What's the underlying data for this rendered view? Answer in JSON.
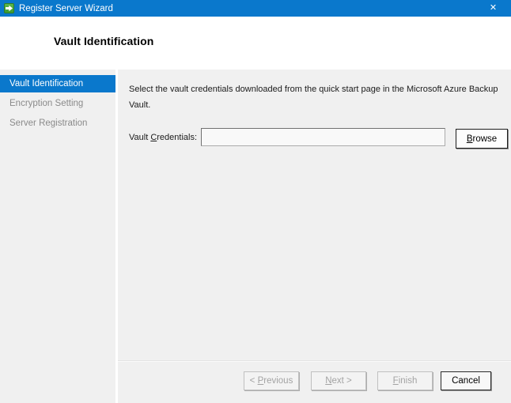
{
  "window": {
    "title": "Register Server Wizard",
    "close_glyph": "✕"
  },
  "header": {
    "title": "Vault Identification"
  },
  "sidebar": {
    "items": [
      {
        "label": "Vault Identification",
        "selected": true
      },
      {
        "label": "Encryption Setting",
        "selected": false
      },
      {
        "label": "Server Registration",
        "selected": false
      }
    ]
  },
  "content": {
    "description": "Select the vault credentials downloaded from the quick start page in the Microsoft Azure Backup Vault.",
    "field": {
      "label_pre": "Vault ",
      "label_key": "C",
      "label_post": "redentials:",
      "value": "",
      "browse_key": "B",
      "browse_post": "rowse"
    }
  },
  "footer": {
    "previous": {
      "pre": "< ",
      "key": "P",
      "post": "revious",
      "enabled": false
    },
    "next": {
      "pre": "",
      "key": "N",
      "post": "ext >",
      "enabled": false
    },
    "finish": {
      "pre": "",
      "key": "F",
      "post": "inish",
      "enabled": false
    },
    "cancel_label": "Cancel"
  },
  "colors": {
    "titlebar": "#0a78cc",
    "selection": "#0a78cc",
    "window_bg": "#f0f0f0",
    "header_bg": "#ffffff",
    "divider": "#ffffff",
    "app_icon_green": "#3c9a31",
    "app_icon_green_light": "#5cb84a"
  }
}
